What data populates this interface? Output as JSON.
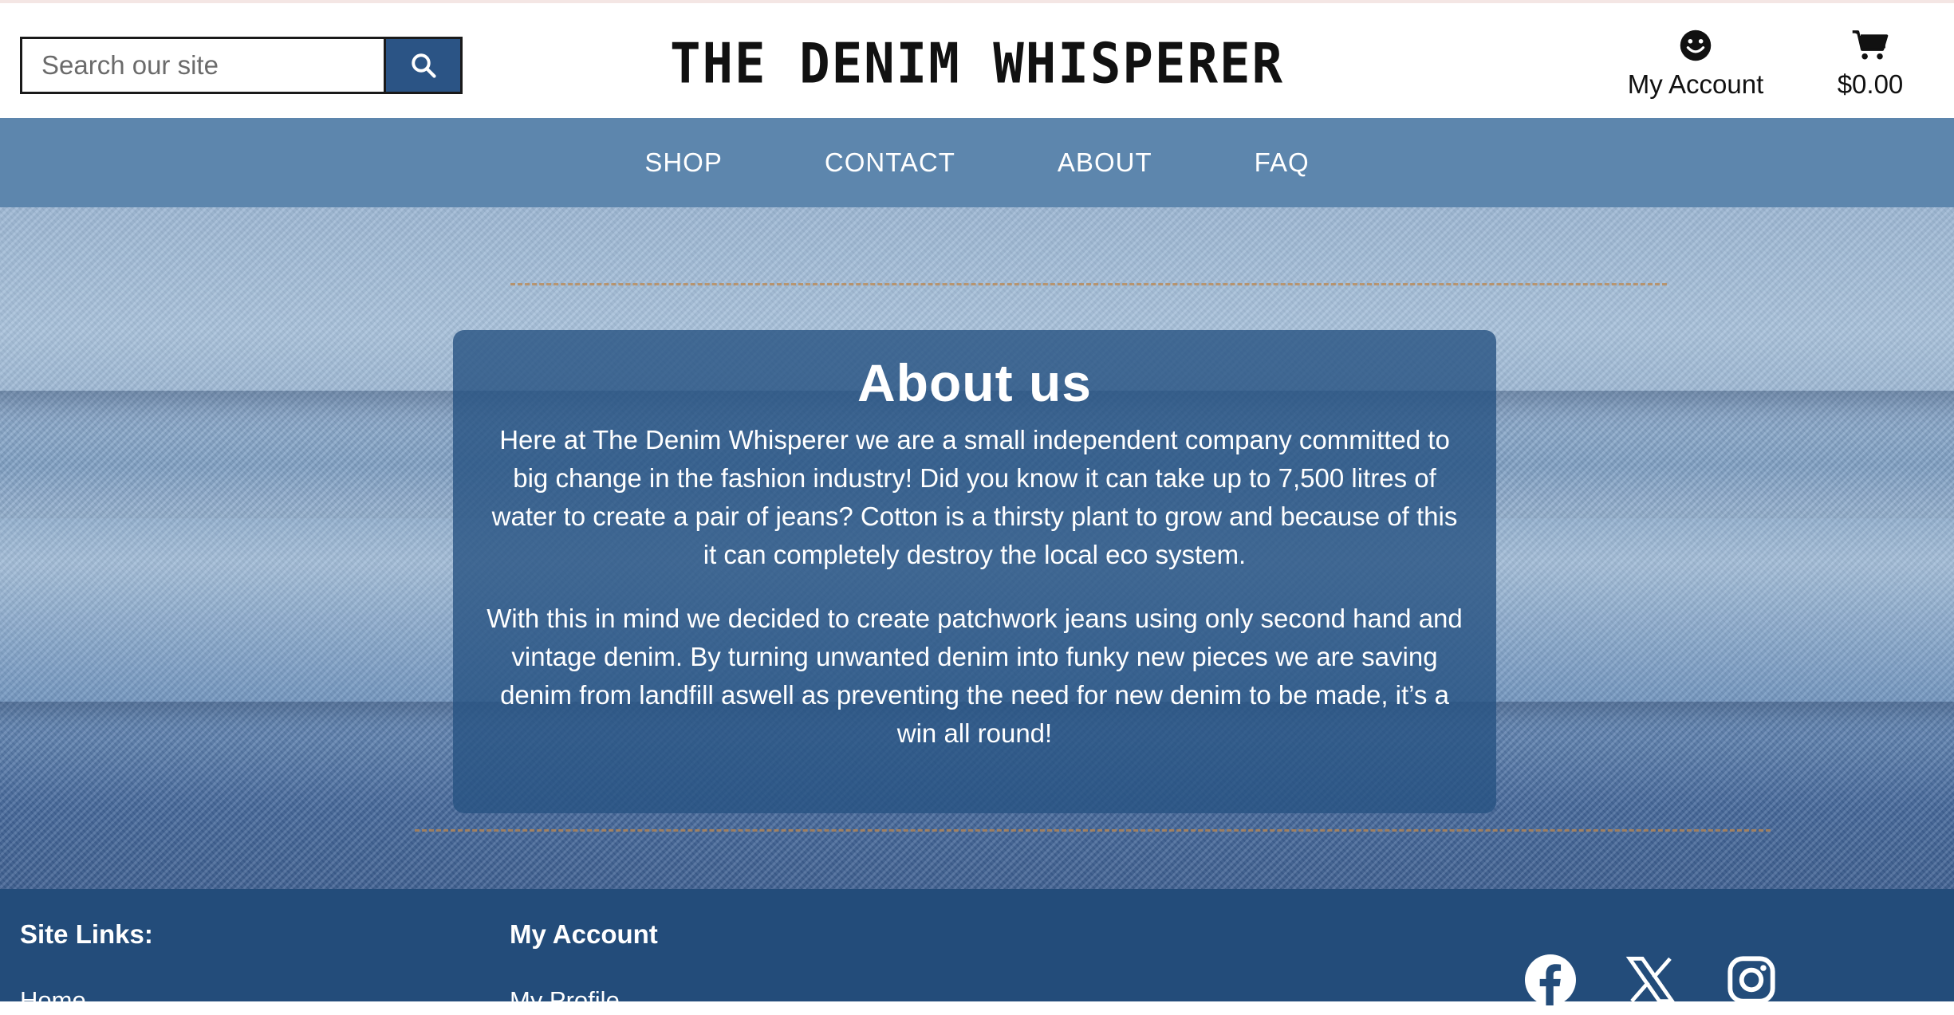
{
  "header": {
    "search": {
      "placeholder": "Search our site",
      "icon": "search-icon"
    },
    "logo_text": "THE DENIM WHISPERER",
    "account": {
      "label": "My Account",
      "icon": "smiley-icon"
    },
    "cart": {
      "total": "$0.00",
      "icon": "cart-icon"
    }
  },
  "nav": {
    "items": [
      {
        "label": "SHOP"
      },
      {
        "label": "CONTACT"
      },
      {
        "label": "ABOUT"
      },
      {
        "label": "FAQ"
      }
    ]
  },
  "about": {
    "title": "About us",
    "paragraphs": [
      "Here at The Denim Whisperer we are a small independent company committed to big change in the fashion industry! Did you know it can take up to 7,500 litres of water to create a pair of jeans? Cotton is a thirsty plant to grow and because of this it can completely destroy the local eco system.",
      "With this in mind we decided to create patchwork jeans using only second hand and vintage denim. By turning unwanted denim into funky new pieces we are saving denim from landfill aswell as preventing the need for new denim to be made, it’s a win all round!"
    ]
  },
  "footer": {
    "site_links": {
      "heading": "Site Links:",
      "first_link": "Home"
    },
    "my_account": {
      "heading": "My Account",
      "first_link": "My Profile"
    },
    "social": [
      "facebook-icon",
      "x-icon",
      "instagram-icon"
    ]
  },
  "colors": {
    "nav_bg": "#5d86ad",
    "footer_bg": "#234c7a",
    "search_button": "#2b5485",
    "card_bg": "#275282"
  }
}
